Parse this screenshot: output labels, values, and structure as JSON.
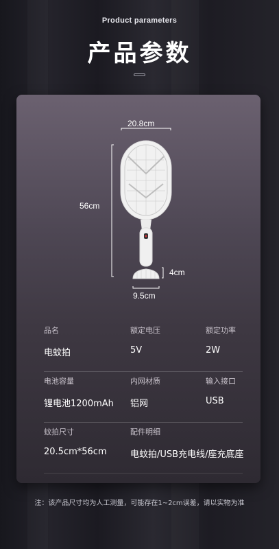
{
  "header": {
    "subtitle": "Product parameters",
    "title": "产品参数"
  },
  "product": {
    "dims": {
      "width": "20.8cm",
      "height": "56cm",
      "base_height": "4cm",
      "base_width": "9.5cm"
    },
    "colors": {
      "racket": "#ececec",
      "indicator": "#e0343a"
    }
  },
  "specs": [
    [
      {
        "label": "品名",
        "value": "电蚊拍"
      },
      {
        "label": "额定电压",
        "value": "5V"
      },
      {
        "label": "额定功率",
        "value": "2W"
      }
    ],
    [
      {
        "label": "电池容量",
        "value": "锂电池1200mAh"
      },
      {
        "label": "内网材质",
        "value": "铝网"
      },
      {
        "label": "输入接口",
        "value": "USB"
      }
    ],
    [
      {
        "label": "蚊拍尺寸",
        "value": "20.5cm*56cm"
      },
      {
        "label": "配件明细",
        "value": "电蚊拍/USB充电线/座充底座"
      }
    ]
  ],
  "note": "注：该产品尺寸均为人工测量，可能存在1~2cm误差，请以实物为准"
}
